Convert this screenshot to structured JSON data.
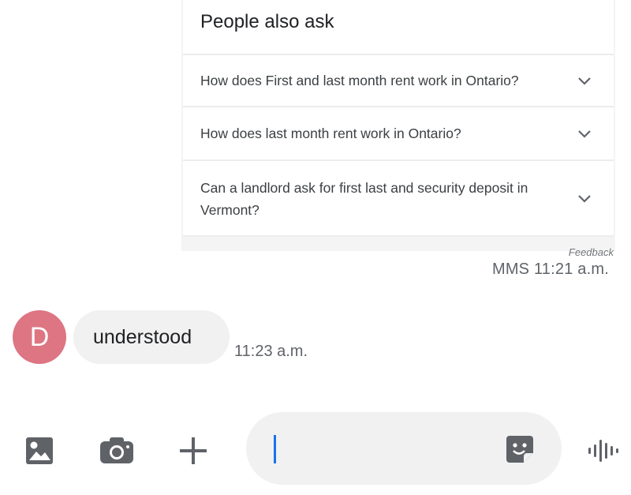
{
  "shared_card": {
    "title": "People also ask",
    "questions": [
      "How does First and last month rent work in Ontario?",
      "How does last month rent work in Ontario?",
      "Can a landlord ask for first last and security deposit in Vermont?"
    ],
    "feedback_label": "Feedback"
  },
  "mms_message": {
    "meta": "MMS 11:21 a.m."
  },
  "incoming_message": {
    "avatar_initial": "D",
    "text": "understood",
    "time": "11:23 a.m."
  },
  "compose": {
    "value": "",
    "icons": [
      "gallery-icon",
      "camera-icon",
      "plus-icon",
      "sticker-icon",
      "voice-icon"
    ]
  },
  "colors": {
    "avatar": "#dd7582",
    "bubble": "#f1f1f1",
    "caret": "#1a73e8",
    "icon": "#5f6368"
  }
}
